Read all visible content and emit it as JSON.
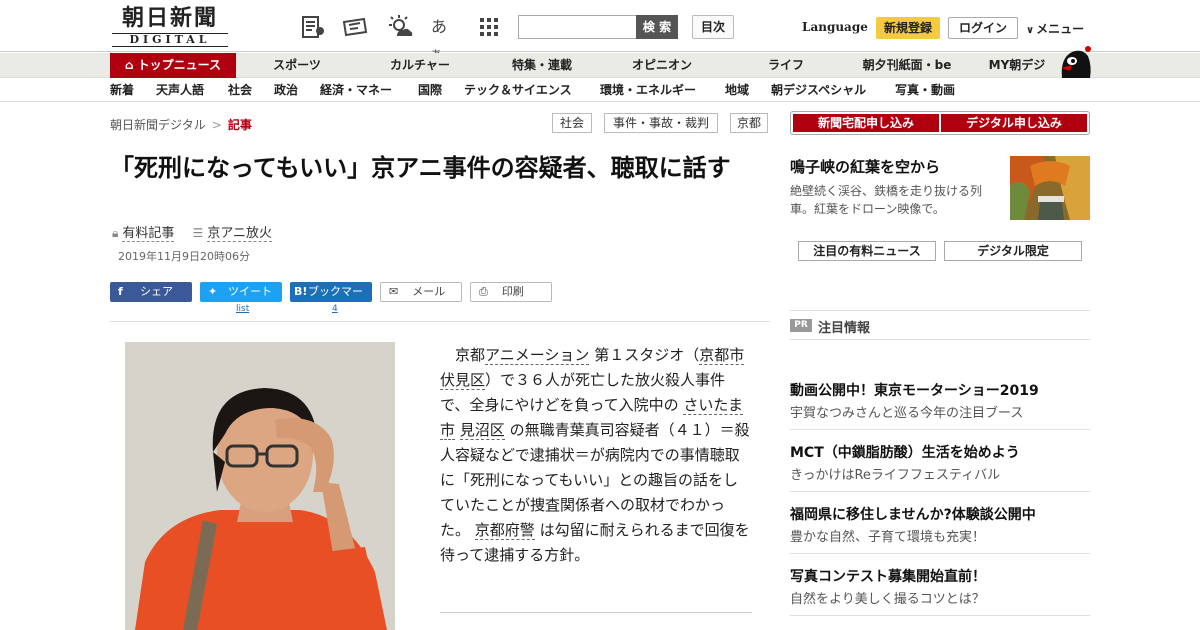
{
  "logo": {
    "name_jp": "朝日新聞",
    "name_en": "DIGITAL"
  },
  "header": {
    "search_placeholder": "",
    "search_button": "検 索",
    "index_button": "目次",
    "language": "Language",
    "register": "新規登録",
    "login": "ログイン",
    "menu": "メニュー"
  },
  "nav_primary": [
    "トップニュース",
    "スポーツ",
    "カルチャー",
    "特集・連載",
    "オピニオン",
    "ライフ",
    "朝夕刊紙面・be",
    "MY朝デジ"
  ],
  "nav_secondary": [
    "新着",
    "天声人語",
    "社会",
    "政治",
    "経済・マネー",
    "国際",
    "テック＆サイエンス",
    "環境・エネルギー",
    "地域",
    "朝デジスペシャル",
    "写真・動画"
  ],
  "breadcrumb": {
    "home": "朝日新聞デジタル",
    "sep": ">",
    "current": "記事"
  },
  "tags": [
    "社会",
    "事件・事故・裁判",
    "京都"
  ],
  "article": {
    "title": "「死刑になってもいい」京アニ事件の容疑者、聴取に話す",
    "paid_label": "有料記事",
    "series_label": "京アニ放火",
    "date": "2019年11月9日20時06分",
    "body": [
      {
        "t": "　京都",
        "u": false
      },
      {
        "t": "アニメーション",
        "u": true
      },
      {
        "t": " 第１スタジオ（",
        "u": false
      },
      {
        "t": "京都市",
        "u": true
      },
      {
        "t": " ",
        "u": false
      },
      {
        "t": "伏見区",
        "u": true
      },
      {
        "t": "）で３６人が死亡した放火殺人事件で、全身にやけどを負って入院中の ",
        "u": false
      },
      {
        "t": "さいたま市",
        "u": true
      },
      {
        "t": " ",
        "u": false
      },
      {
        "t": "見沼区",
        "u": true
      },
      {
        "t": " の無職青葉真司容疑者（４１）＝殺人容疑などで逮捕状＝が病院内での事情聴取に「死刑になってもいい」との趣旨の話をしていたことが捜査関係者への取材でわかった。 ",
        "u": false
      },
      {
        "t": "京都府警",
        "u": true
      },
      {
        "t": " は勾留に耐えられるまで回復を待って逮捕する方針。",
        "u": false
      }
    ]
  },
  "share": {
    "facebook": "シェア",
    "twitter": "ツイート",
    "hatena": "ブックマーク",
    "mail": "メール",
    "print": "印刷",
    "twitter_count": "list",
    "hatena_count": "4"
  },
  "sidebar": {
    "promo": [
      "新聞宅配申し込み",
      "デジタル申し込み"
    ],
    "feature_title": "鳴子峡の紅葉を空から",
    "feature_desc": "絶壁続く渓谷、鉄橋を走り抜ける列車。紅葉をドローン映像で。",
    "picks": [
      "注目の有料ニュース",
      "デジタル限定"
    ],
    "pr_badge": "PR",
    "pr_label": "注目情報",
    "pr_items": [
      {
        "headline": "動画公開中！東京モーターショー2019",
        "sub": "宇賀なつみさんと巡る今年の注目ブース"
      },
      {
        "headline": "MCT（中鎖脂肪酸）生活を始めよう",
        "sub": "きっかけはReライフフェスティバル"
      },
      {
        "headline": "福岡県に移住しませんか?体験談公開中",
        "sub": "豊かな自然、子育て環境も充実！"
      },
      {
        "headline": "写真コンテスト募集開始直前！",
        "sub": "自然をより美しく撮るコツとは？"
      }
    ]
  },
  "colors": {
    "brand_red": "#b0000f",
    "facebook": "#3b5998",
    "twitter": "#1da1f2",
    "hatena": "#1d6fb8",
    "register_yellow": "#f4cb3e"
  }
}
